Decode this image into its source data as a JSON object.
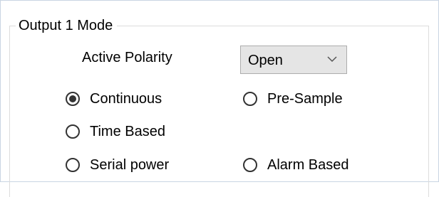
{
  "group": {
    "title": "Output 1 Mode"
  },
  "polarity": {
    "label": "Active Polarity",
    "value": "Open",
    "chevron_icon": "chevron-down-icon"
  },
  "modes": [
    {
      "label": "Continuous",
      "selected": true
    },
    {
      "label": "Pre-Sample",
      "selected": false
    },
    {
      "label": "Time Based",
      "selected": false
    },
    {
      "label": "Serial power",
      "selected": false
    },
    {
      "label": "Alarm Based",
      "selected": false
    }
  ],
  "colors": {
    "frame_border": "#c9d5e3",
    "group_border": "#dcdcdc",
    "combo_background": "#e5e5e5",
    "combo_border": "#adadad",
    "radio": "#333333"
  }
}
